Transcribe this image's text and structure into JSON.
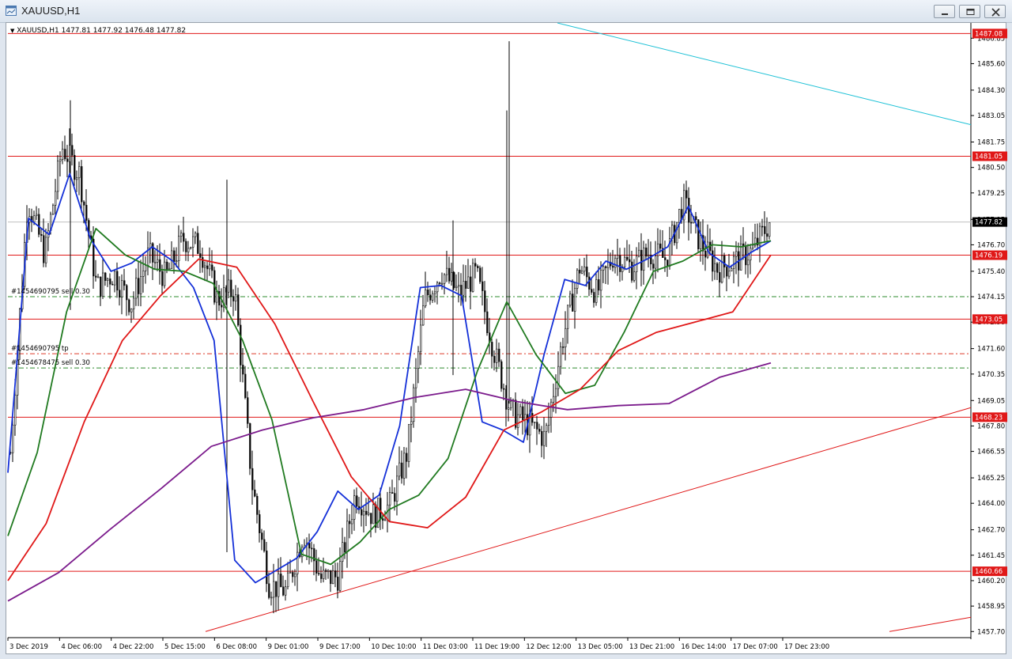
{
  "window": {
    "title": "XAUUSD,H1"
  },
  "chart": {
    "symbol_info": "XAUUSD,H1  1477.81 1477.92 1476.48 1477.82",
    "current_price": "1477.82"
  },
  "orders": [
    {
      "text": "#1454690795 sell 0.30",
      "color": "#2e8b2e",
      "price": 1474.15
    },
    {
      "text": "#1454690795 tp",
      "color": "#dd3b2a",
      "price": 1471.35
    },
    {
      "text": "#1454678475 sell 0.30",
      "color": "#2e8b2e",
      "price": 1470.65
    }
  ],
  "level_labels": [
    "1487.08",
    "1481.05",
    "1476.19",
    "1473.05",
    "1468.23",
    "1460.66"
  ],
  "chart_data": {
    "type": "candlestick",
    "symbol": "XAUUSD",
    "timeframe": "H1",
    "ylim": [
      1457.4,
      1487.6
    ],
    "y_ticks": [
      "1486.85",
      "1485.60",
      "1484.30",
      "1483.05",
      "1481.75",
      "1480.50",
      "1479.25",
      "1477.95",
      "1476.70",
      "1475.40",
      "1474.15",
      "1472.90",
      "1471.60",
      "1470.35",
      "1469.05",
      "1467.80",
      "1466.55",
      "1465.25",
      "1464.00",
      "1462.70",
      "1461.45",
      "1460.20",
      "1458.95",
      "1457.70"
    ],
    "x_ticks": [
      "3 Dec 2019",
      "4 Dec 06:00",
      "4 Dec 22:00",
      "5 Dec 15:00",
      "6 Dec 08:00",
      "9 Dec 01:00",
      "9 Dec 17:00",
      "10 Dec 10:00",
      "11 Dec 03:00",
      "11 Dec 19:00",
      "12 Dec 12:00",
      "13 Dec 05:00",
      "13 Dec 21:00",
      "16 Dec 14:00",
      "17 Dec 07:00",
      "17 Dec 23:00"
    ],
    "last_close": 1477.82,
    "horizontal_levels": [
      1487.08,
      1481.05,
      1476.19,
      1473.05,
      1468.23,
      1460.66
    ],
    "ohlc_anchor_closes": [
      1466.5,
      1478.9,
      1476.2,
      1481.5,
      1480.2,
      1474.6,
      1475.3,
      1473.8,
      1476.2,
      1475.1,
      1477.0,
      1476.6,
      1474.0,
      1474.5,
      1465.0,
      1460.0,
      1459.7,
      1462.6,
      1460.3,
      1460.4,
      1464.5,
      1463.4,
      1463.9,
      1466.5,
      1474.0,
      1475.4,
      1474.3,
      1475.3,
      1471.6,
      1468.5,
      1467.9,
      1467.2,
      1472.0,
      1475.6,
      1474.3,
      1476.3,
      1475.6,
      1476.3,
      1476.0,
      1478.8,
      1476.8,
      1475.5,
      1475.9,
      1476.4,
      1477.82
    ],
    "indicators": [
      {
        "name": "MA fast",
        "color": "#1430d8",
        "values": [
          1465.5,
          1478.0,
          1477.2,
          1480.2,
          1477.0,
          1475.4,
          1475.8,
          1476.6,
          1475.9,
          1474.6,
          1472.0,
          1461.2,
          1460.1,
          1460.7,
          1461.3,
          1462.6,
          1464.6,
          1463.7,
          1464.4,
          1467.8,
          1474.6,
          1474.7,
          1474.2,
          1468.0,
          1467.6,
          1467.0,
          1471.3,
          1475.0,
          1474.7,
          1475.9,
          1475.5,
          1476.0,
          1476.6,
          1478.6,
          1476.3,
          1475.6,
          1476.3,
          1476.9
        ]
      },
      {
        "name": "MA medium",
        "color": "#207a20",
        "values": [
          1462.4,
          1466.5,
          1473.4,
          1477.5,
          1476.2,
          1475.5,
          1475.4,
          1474.8,
          1472.0,
          1468.1,
          1461.5,
          1461.0,
          1462.1,
          1463.7,
          1464.4,
          1466.2,
          1470.5,
          1473.9,
          1471.3,
          1469.4,
          1469.8,
          1472.4,
          1475.4,
          1475.9,
          1476.7,
          1476.6,
          1476.9
        ]
      },
      {
        "name": "MA slow",
        "color": "#e01818",
        "values": [
          1460.2,
          1463.0,
          1468.0,
          1472.0,
          1474.2,
          1476.0,
          1475.6,
          1472.8,
          1469.0,
          1465.3,
          1463.1,
          1462.8,
          1464.3,
          1467.6,
          1468.5,
          1469.6,
          1471.5,
          1472.4,
          1472.9,
          1473.4,
          1476.2
        ]
      },
      {
        "name": "MA very slow",
        "color": "#7b1b8c",
        "values": [
          1459.2,
          1460.6,
          1462.7,
          1464.7,
          1466.8,
          1467.6,
          1468.2,
          1468.6,
          1469.2,
          1469.6,
          1469.0,
          1468.6,
          1468.8,
          1468.9,
          1470.2,
          1470.9
        ]
      }
    ],
    "trendlines": [
      {
        "color": "#1ec1d6",
        "from": [
          "12 Dec",
          1487.6
        ],
        "to": [
          "right edge",
          1482.6
        ]
      },
      {
        "color": "#e01818",
        "from": [
          "6 Dec 08:00",
          1457.7
        ],
        "to": [
          "right edge",
          1468.7
        ]
      },
      {
        "color": "#e01818",
        "from": [
          "16 Dec",
          1457.7
        ],
        "to": [
          "right edge",
          1458.4
        ]
      }
    ]
  }
}
